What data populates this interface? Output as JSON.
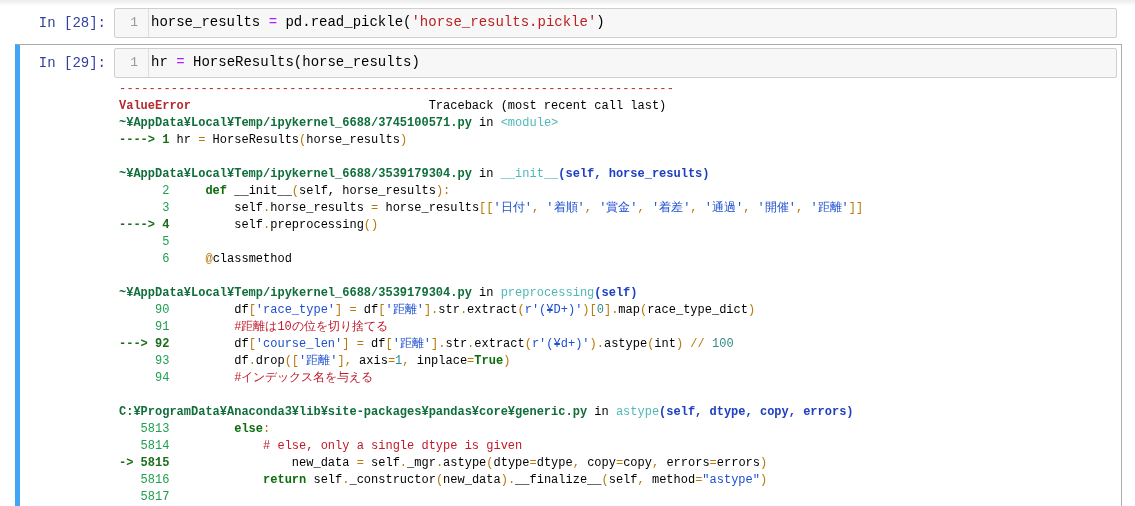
{
  "cells": [
    {
      "prompt": "In [28]:",
      "selected": false,
      "line_number": "1",
      "code": [
        {
          "text": "horse_results ",
          "kind": "plain"
        },
        {
          "text": "=",
          "kind": "assign"
        },
        {
          "text": " pd.read_pickle(",
          "kind": "plain"
        },
        {
          "text": "'horse_results.pickle'",
          "kind": "literal"
        },
        {
          "text": ")",
          "kind": "plain"
        }
      ]
    },
    {
      "prompt": "In [29]:",
      "selected": true,
      "line_number": "1",
      "code": [
        {
          "text": "hr ",
          "kind": "plain"
        },
        {
          "text": "=",
          "kind": "assign"
        },
        {
          "text": " HorseResults(horse_results)",
          "kind": "plain"
        }
      ],
      "output": {
        "rule": "---------------------------------------------------------------------------",
        "error_line": [
          {
            "text": "ValueError",
            "kind": "ename"
          },
          {
            "text": "                                 Traceback (most recent call last)",
            "kind": "plain"
          }
        ],
        "frames": [
          {
            "header": [
              {
                "text": "~¥AppData¥Local¥Temp/ipykernel_6688/3745100571.py",
                "kind": "path"
              },
              {
                "text": " in ",
                "kind": "plain"
              },
              {
                "text": "<module>",
                "kind": "func"
              }
            ],
            "lines": [
              [
                {
                  "text": "----> 1 ",
                  "kind": "arrow"
                },
                {
                  "text": "hr ",
                  "kind": "plain"
                },
                {
                  "text": "=",
                  "kind": "op"
                },
                {
                  "text": " HorseResults",
                  "kind": "plain"
                },
                {
                  "text": "(",
                  "kind": "op"
                },
                {
                  "text": "horse_results",
                  "kind": "plain"
                },
                {
                  "text": ")",
                  "kind": "op"
                }
              ]
            ]
          },
          {
            "header": [
              {
                "text": "~¥AppData¥Local¥Temp/ipykernel_6688/3539179304.py",
                "kind": "path"
              },
              {
                "text": " in ",
                "kind": "plain"
              },
              {
                "text": "__init__",
                "kind": "func"
              },
              {
                "text": "(self, horse_results)",
                "kind": "args"
              }
            ],
            "lines": [
              [
                {
                  "text": "      2     ",
                  "kind": "lineno"
                },
                {
                  "text": "def",
                  "kind": "keyword"
                },
                {
                  "text": " __init__",
                  "kind": "plain"
                },
                {
                  "text": "(",
                  "kind": "op"
                },
                {
                  "text": "self, horse_results",
                  "kind": "plain"
                },
                {
                  "text": "):",
                  "kind": "op"
                }
              ],
              [
                {
                  "text": "      3 ",
                  "kind": "lineno"
                },
                {
                  "text": "        self",
                  "kind": "plain"
                },
                {
                  "text": ".",
                  "kind": "op"
                },
                {
                  "text": "horse_results ",
                  "kind": "plain"
                },
                {
                  "text": "=",
                  "kind": "op"
                },
                {
                  "text": " horse_results",
                  "kind": "plain"
                },
                {
                  "text": "[[",
                  "kind": "op"
                },
                {
                  "text": "'日付'",
                  "kind": "string"
                },
                {
                  "text": ", ",
                  "kind": "op"
                },
                {
                  "text": "'着順'",
                  "kind": "string"
                },
                {
                  "text": ", ",
                  "kind": "op"
                },
                {
                  "text": "'賞金'",
                  "kind": "string"
                },
                {
                  "text": ", ",
                  "kind": "op"
                },
                {
                  "text": "'着差'",
                  "kind": "string"
                },
                {
                  "text": ", ",
                  "kind": "op"
                },
                {
                  "text": "'通過'",
                  "kind": "string"
                },
                {
                  "text": ", ",
                  "kind": "op"
                },
                {
                  "text": "'開催'",
                  "kind": "string"
                },
                {
                  "text": ", ",
                  "kind": "op"
                },
                {
                  "text": "'距離'",
                  "kind": "string"
                },
                {
                  "text": "]]",
                  "kind": "op"
                }
              ],
              [
                {
                  "text": "----> 4 ",
                  "kind": "arrow"
                },
                {
                  "text": "        self",
                  "kind": "plain"
                },
                {
                  "text": ".",
                  "kind": "op"
                },
                {
                  "text": "preprocessing",
                  "kind": "plain"
                },
                {
                  "text": "()",
                  "kind": "op"
                }
              ],
              [
                {
                  "text": "      5",
                  "kind": "lineno"
                }
              ],
              [
                {
                  "text": "      6     ",
                  "kind": "lineno"
                },
                {
                  "text": "@",
                  "kind": "op"
                },
                {
                  "text": "classmethod",
                  "kind": "plain"
                }
              ]
            ]
          },
          {
            "header": [
              {
                "text": "~¥AppData¥Local¥Temp/ipykernel_6688/3539179304.py",
                "kind": "path"
              },
              {
                "text": " in ",
                "kind": "plain"
              },
              {
                "text": "preprocessing",
                "kind": "func"
              },
              {
                "text": "(self)",
                "kind": "args"
              }
            ],
            "lines": [
              [
                {
                  "text": "     90 ",
                  "kind": "lineno"
                },
                {
                  "text": "        df",
                  "kind": "plain"
                },
                {
                  "text": "[",
                  "kind": "op"
                },
                {
                  "text": "'race_type'",
                  "kind": "string"
                },
                {
                  "text": "]",
                  "kind": "op"
                },
                {
                  "text": " = ",
                  "kind": "op"
                },
                {
                  "text": "df",
                  "kind": "plain"
                },
                {
                  "text": "[",
                  "kind": "op"
                },
                {
                  "text": "'距離'",
                  "kind": "string"
                },
                {
                  "text": "].",
                  "kind": "op"
                },
                {
                  "text": "str",
                  "kind": "plain"
                },
                {
                  "text": ".",
                  "kind": "op"
                },
                {
                  "text": "extract",
                  "kind": "plain"
                },
                {
                  "text": "(",
                  "kind": "op"
                },
                {
                  "text": "r'(¥D+)'",
                  "kind": "string"
                },
                {
                  "text": ")[",
                  "kind": "op"
                },
                {
                  "text": "0",
                  "kind": "number"
                },
                {
                  "text": "].",
                  "kind": "op"
                },
                {
                  "text": "map",
                  "kind": "plain"
                },
                {
                  "text": "(",
                  "kind": "op"
                },
                {
                  "text": "race_type_dict",
                  "kind": "plain"
                },
                {
                  "text": ")",
                  "kind": "op"
                }
              ],
              [
                {
                  "text": "     91 ",
                  "kind": "lineno"
                },
                {
                  "text": "        #距離は10の位を切り捨てる",
                  "kind": "comment"
                }
              ],
              [
                {
                  "text": "---> 92 ",
                  "kind": "arrow"
                },
                {
                  "text": "        df",
                  "kind": "plain"
                },
                {
                  "text": "[",
                  "kind": "op"
                },
                {
                  "text": "'course_len'",
                  "kind": "string"
                },
                {
                  "text": "]",
                  "kind": "op"
                },
                {
                  "text": " = ",
                  "kind": "op"
                },
                {
                  "text": "df",
                  "kind": "plain"
                },
                {
                  "text": "[",
                  "kind": "op"
                },
                {
                  "text": "'距離'",
                  "kind": "string"
                },
                {
                  "text": "].",
                  "kind": "op"
                },
                {
                  "text": "str",
                  "kind": "plain"
                },
                {
                  "text": ".",
                  "kind": "op"
                },
                {
                  "text": "extract",
                  "kind": "plain"
                },
                {
                  "text": "(",
                  "kind": "op"
                },
                {
                  "text": "r'(¥d+)'",
                  "kind": "string"
                },
                {
                  "text": ").",
                  "kind": "op"
                },
                {
                  "text": "astype",
                  "kind": "plain"
                },
                {
                  "text": "(",
                  "kind": "op"
                },
                {
                  "text": "int",
                  "kind": "plain"
                },
                {
                  "text": ")",
                  "kind": "op"
                },
                {
                  "text": " // ",
                  "kind": "op"
                },
                {
                  "text": "100",
                  "kind": "number"
                }
              ],
              [
                {
                  "text": "     93 ",
                  "kind": "lineno"
                },
                {
                  "text": "        df",
                  "kind": "plain"
                },
                {
                  "text": ".",
                  "kind": "op"
                },
                {
                  "text": "drop",
                  "kind": "plain"
                },
                {
                  "text": "([",
                  "kind": "op"
                },
                {
                  "text": "'距離'",
                  "kind": "string"
                },
                {
                  "text": "], ",
                  "kind": "op"
                },
                {
                  "text": "axis",
                  "kind": "plain"
                },
                {
                  "text": "=",
                  "kind": "op"
                },
                {
                  "text": "1",
                  "kind": "number"
                },
                {
                  "text": ", ",
                  "kind": "op"
                },
                {
                  "text": "inplace",
                  "kind": "plain"
                },
                {
                  "text": "=",
                  "kind": "op"
                },
                {
                  "text": "True",
                  "kind": "keyword"
                },
                {
                  "text": ")",
                  "kind": "op"
                }
              ],
              [
                {
                  "text": "     94 ",
                  "kind": "lineno"
                },
                {
                  "text": "        #インデックス名を与える",
                  "kind": "comment"
                }
              ]
            ]
          },
          {
            "header": [
              {
                "text": "C:¥ProgramData¥Anaconda3¥lib¥site-packages¥pandas¥core¥generic.py",
                "kind": "path"
              },
              {
                "text": " in ",
                "kind": "plain"
              },
              {
                "text": "astype",
                "kind": "func"
              },
              {
                "text": "(self, dtype, copy, errors)",
                "kind": "args"
              }
            ],
            "lines": [
              [
                {
                  "text": "   5813 ",
                  "kind": "lineno"
                },
                {
                  "text": "        else",
                  "kind": "keyword"
                },
                {
                  "text": ":",
                  "kind": "op"
                }
              ],
              [
                {
                  "text": "   5814 ",
                  "kind": "lineno"
                },
                {
                  "text": "            # else, only a single dtype is given",
                  "kind": "comment"
                }
              ],
              [
                {
                  "text": "-> 5815 ",
                  "kind": "arrow"
                },
                {
                  "text": "                new_data ",
                  "kind": "plain"
                },
                {
                  "text": "=",
                  "kind": "op"
                },
                {
                  "text": " self",
                  "kind": "plain"
                },
                {
                  "text": ".",
                  "kind": "op"
                },
                {
                  "text": "_mgr",
                  "kind": "plain"
                },
                {
                  "text": ".",
                  "kind": "op"
                },
                {
                  "text": "astype",
                  "kind": "plain"
                },
                {
                  "text": "(",
                  "kind": "op"
                },
                {
                  "text": "dtype",
                  "kind": "plain"
                },
                {
                  "text": "=",
                  "kind": "op"
                },
                {
                  "text": "dtype",
                  "kind": "plain"
                },
                {
                  "text": ", ",
                  "kind": "op"
                },
                {
                  "text": "copy",
                  "kind": "plain"
                },
                {
                  "text": "=",
                  "kind": "op"
                },
                {
                  "text": "copy",
                  "kind": "plain"
                },
                {
                  "text": ", ",
                  "kind": "op"
                },
                {
                  "text": "errors",
                  "kind": "plain"
                },
                {
                  "text": "=",
                  "kind": "op"
                },
                {
                  "text": "errors",
                  "kind": "plain"
                },
                {
                  "text": ")",
                  "kind": "op"
                }
              ],
              [
                {
                  "text": "   5816 ",
                  "kind": "lineno"
                },
                {
                  "text": "            return",
                  "kind": "keyword"
                },
                {
                  "text": " self",
                  "kind": "plain"
                },
                {
                  "text": ".",
                  "kind": "op"
                },
                {
                  "text": "_constructor",
                  "kind": "plain"
                },
                {
                  "text": "(",
                  "kind": "op"
                },
                {
                  "text": "new_data",
                  "kind": "plain"
                },
                {
                  "text": ").",
                  "kind": "op"
                },
                {
                  "text": "__finalize__",
                  "kind": "plain"
                },
                {
                  "text": "(",
                  "kind": "op"
                },
                {
                  "text": "self",
                  "kind": "plain"
                },
                {
                  "text": ", ",
                  "kind": "op"
                },
                {
                  "text": "method",
                  "kind": "plain"
                },
                {
                  "text": "=",
                  "kind": "op"
                },
                {
                  "text": "\"astype\"",
                  "kind": "string"
                },
                {
                  "text": ")",
                  "kind": "op"
                }
              ],
              [
                {
                  "text": "   5817",
                  "kind": "lineno"
                }
              ]
            ]
          }
        ]
      }
    }
  ]
}
